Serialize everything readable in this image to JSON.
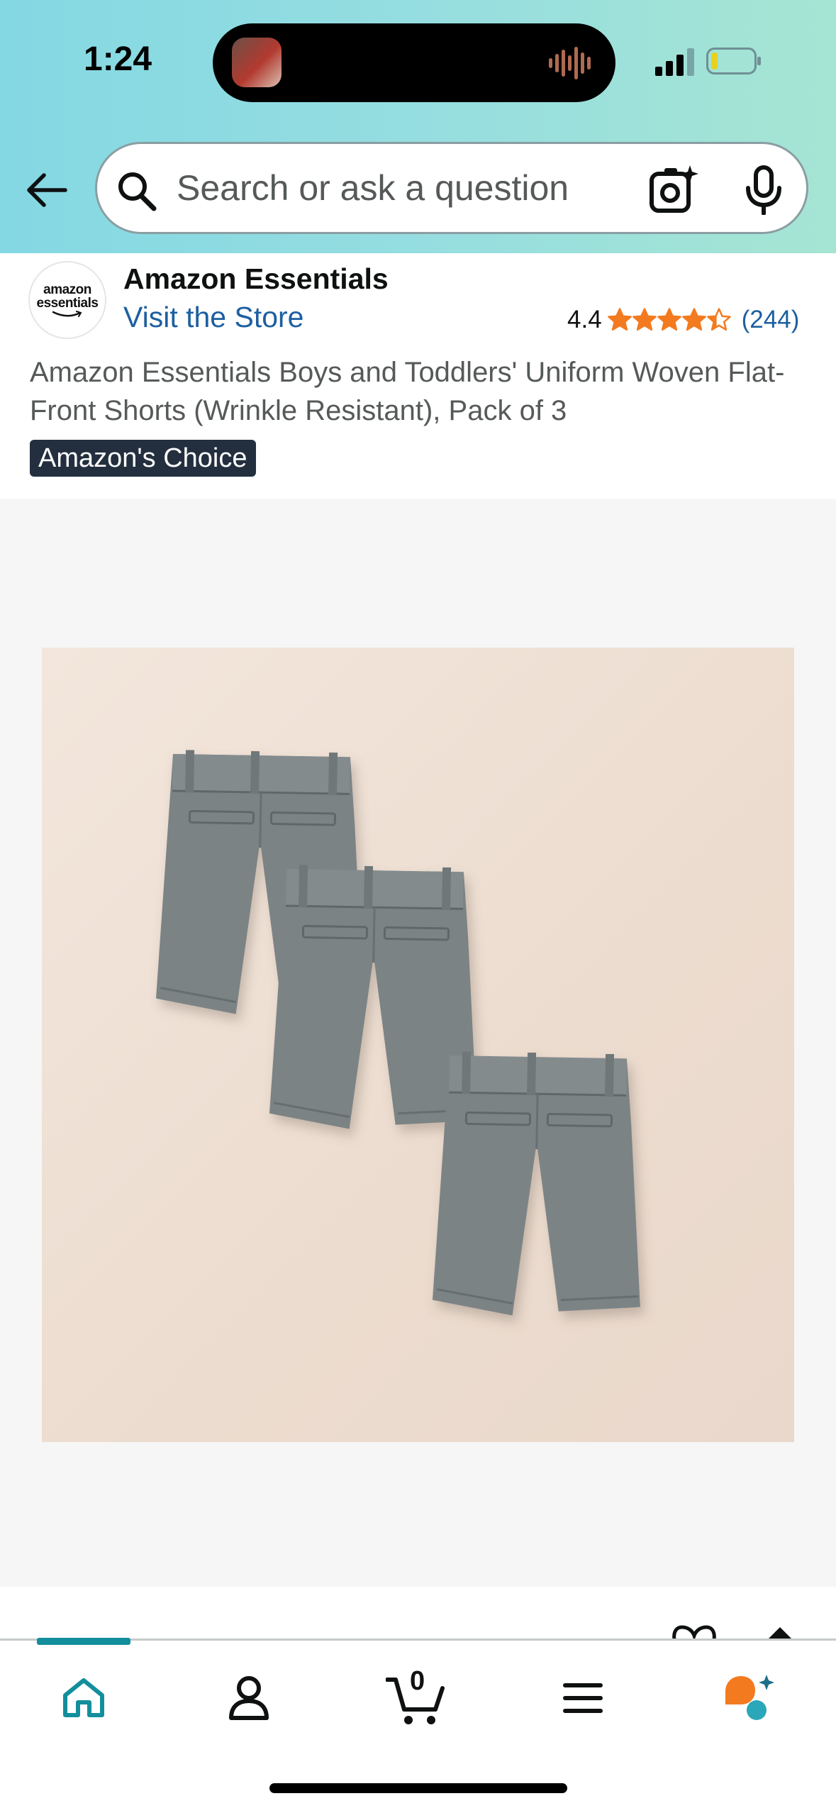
{
  "status_bar": {
    "time": "1:24"
  },
  "search": {
    "placeholder": "Search or ask a question"
  },
  "product": {
    "brand_logo_line1": "amazon",
    "brand_logo_line2": "essentials",
    "brand_name": "Amazon Essentials",
    "store_link": "Visit the Store",
    "rating_value": "4.4",
    "rating_stars": 4.4,
    "rating_count": "(244)",
    "title": "Amazon Essentials Boys and Toddlers' Uniform Woven Flat-Front Shorts (Wrinkle Resistant), Pack of 3",
    "badge": "Amazon's Choice"
  },
  "bottom_nav": {
    "cart_count": "0",
    "active_tab": "home",
    "items": [
      "home-icon",
      "account-icon",
      "cart-icon",
      "menu-icon",
      "rufus-assistant-icon"
    ]
  },
  "colors": {
    "header_gradient_start": "#84d8e3",
    "header_gradient_end": "#a6e5d3",
    "link_blue": "#1d5fa0",
    "star_orange": "#f37a1f",
    "badge_bg": "#232f3e",
    "nav_active": "#138e9c"
  }
}
